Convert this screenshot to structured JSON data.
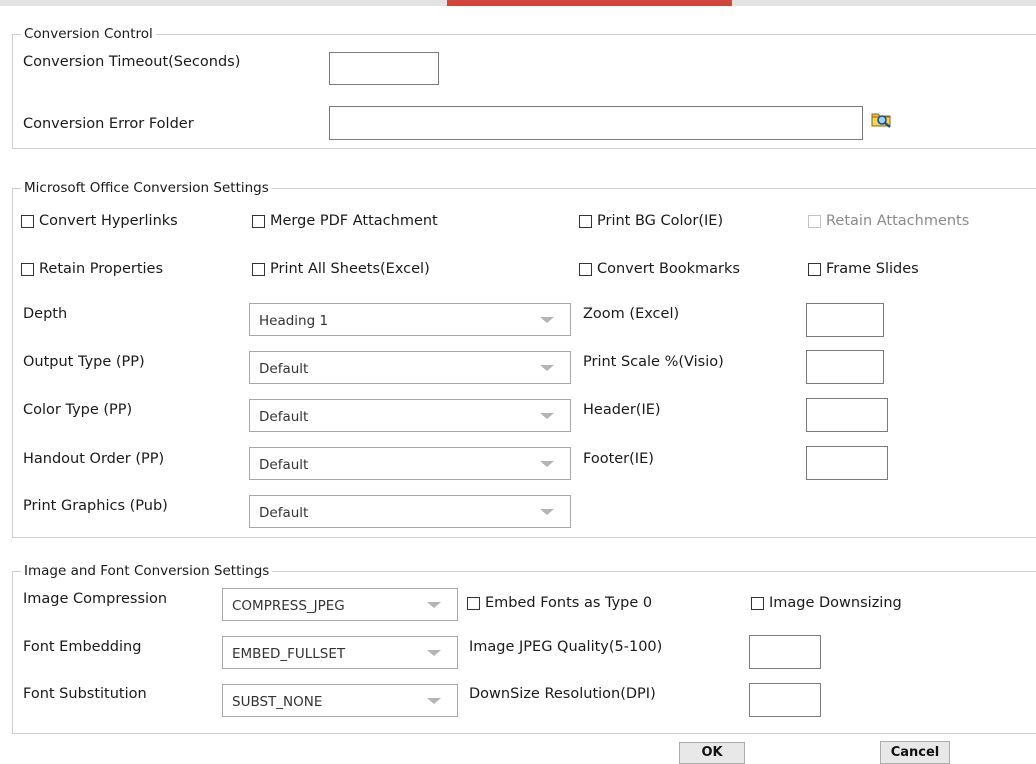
{
  "conversion_control": {
    "legend": "Conversion Control",
    "timeout_label": "Conversion Timeout(Seconds)",
    "timeout_value": "",
    "error_folder_label": "Conversion Error Folder",
    "error_folder_value": "",
    "browse_icon": "folder-search-icon"
  },
  "office": {
    "legend": "Microsoft Office Conversion Settings",
    "checkboxes": [
      {
        "label": "Convert Hyperlinks",
        "checked": false,
        "disabled": false
      },
      {
        "label": "Merge PDF Attachment",
        "checked": false,
        "disabled": false
      },
      {
        "label": "Print BG Color(IE)",
        "checked": false,
        "disabled": false
      },
      {
        "label": "Retain Attachments",
        "checked": false,
        "disabled": true
      },
      {
        "label": "Retain Properties",
        "checked": false,
        "disabled": false
      },
      {
        "label": "Print All Sheets(Excel)",
        "checked": false,
        "disabled": false
      },
      {
        "label": "Convert Bookmarks",
        "checked": false,
        "disabled": false
      },
      {
        "label": "Frame Slides",
        "checked": false,
        "disabled": false
      }
    ],
    "selects": [
      {
        "label": "Depth",
        "value": "Heading 1"
      },
      {
        "label": "Output Type (PP)",
        "value": "Default"
      },
      {
        "label": "Color Type (PP)",
        "value": "Default"
      },
      {
        "label": "Handout Order (PP)",
        "value": "Default"
      },
      {
        "label": "Print Graphics (Pub)",
        "value": "Default"
      }
    ],
    "fields": [
      {
        "label": "Zoom (Excel)",
        "value": ""
      },
      {
        "label": "Print Scale %(Visio)",
        "value": ""
      },
      {
        "label": "Header(IE)",
        "value": ""
      },
      {
        "label": "Footer(IE)",
        "value": ""
      }
    ]
  },
  "image_font": {
    "legend": "Image and Font Conversion Settings",
    "selects": [
      {
        "label": "Image Compression",
        "value": "COMPRESS_JPEG"
      },
      {
        "label": "Font Embedding",
        "value": "EMBED_FULLSET"
      },
      {
        "label": "Font Substitution",
        "value": "SUBST_NONE"
      }
    ],
    "checkboxes": [
      {
        "label": "Embed Fonts as Type 0",
        "checked": false
      },
      {
        "label": "Image Downsizing",
        "checked": false
      }
    ],
    "fields": [
      {
        "label": "Image JPEG Quality(5-100)",
        "value": ""
      },
      {
        "label": "DownSize Resolution(DPI)",
        "value": ""
      }
    ]
  },
  "buttons": {
    "ok": "OK",
    "cancel": "Cancel"
  }
}
